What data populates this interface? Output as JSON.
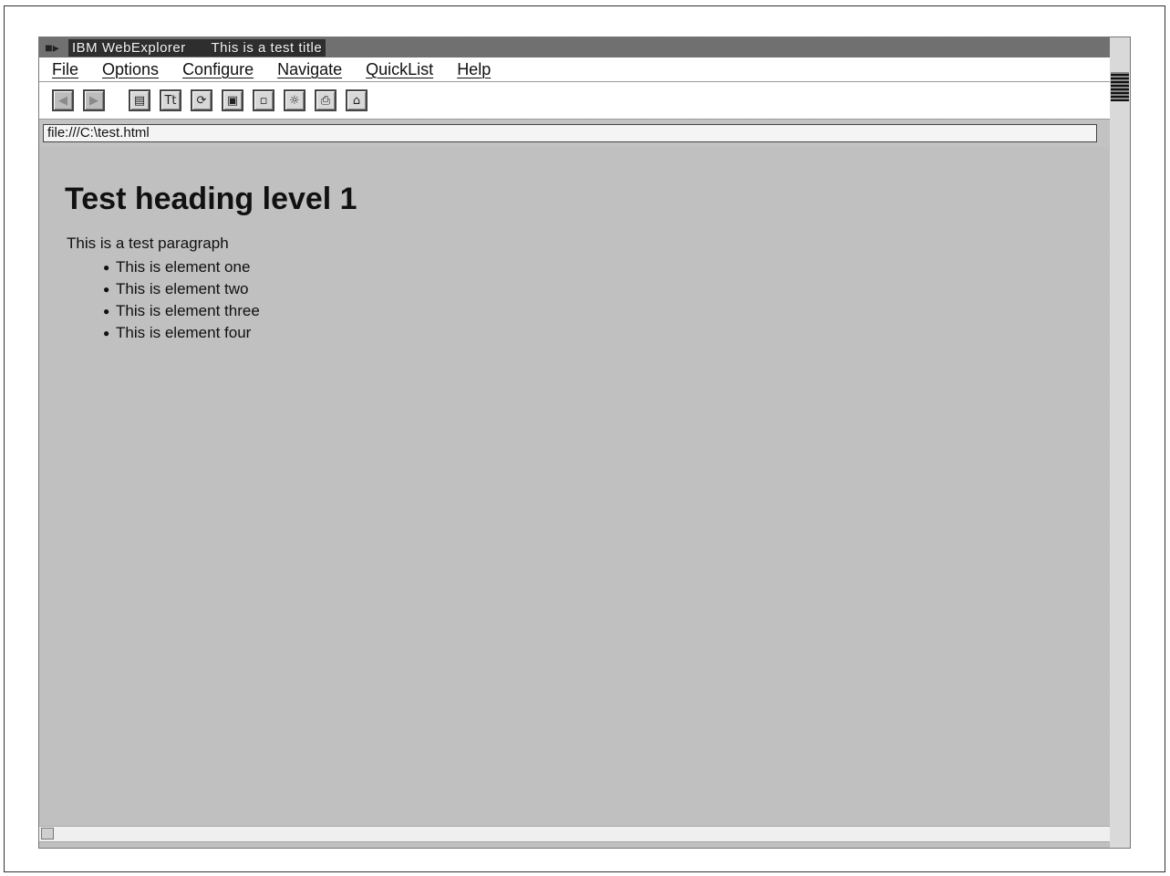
{
  "window": {
    "app_title": "IBM WebExplorer",
    "doc_title": "This is a test title"
  },
  "menubar": {
    "items": [
      "File",
      "Options",
      "Configure",
      "Navigate",
      "QuickList",
      "Help"
    ]
  },
  "toolbar": {
    "buttons": [
      {
        "icon": "back-icon",
        "state": "disabled"
      },
      {
        "icon": "forward-icon",
        "state": "disabled"
      },
      {
        "icon": "screen-icon"
      },
      {
        "icon": "text-icon"
      },
      {
        "icon": "reload-icon"
      },
      {
        "icon": "map-icon"
      },
      {
        "icon": "document-icon"
      },
      {
        "icon": "quicklist-icon"
      },
      {
        "icon": "print-icon"
      },
      {
        "icon": "home-icon"
      }
    ]
  },
  "address": {
    "url": "file:///C:\\test.html"
  },
  "page": {
    "heading": "Test heading level 1",
    "paragraph": "This is a test paragraph",
    "list": [
      "This is element one",
      "This is element two",
      "This is element three",
      "This is element four"
    ]
  },
  "colors": {
    "titlebar": "#8a8a8a",
    "content_bg": "#cfcfcf"
  }
}
